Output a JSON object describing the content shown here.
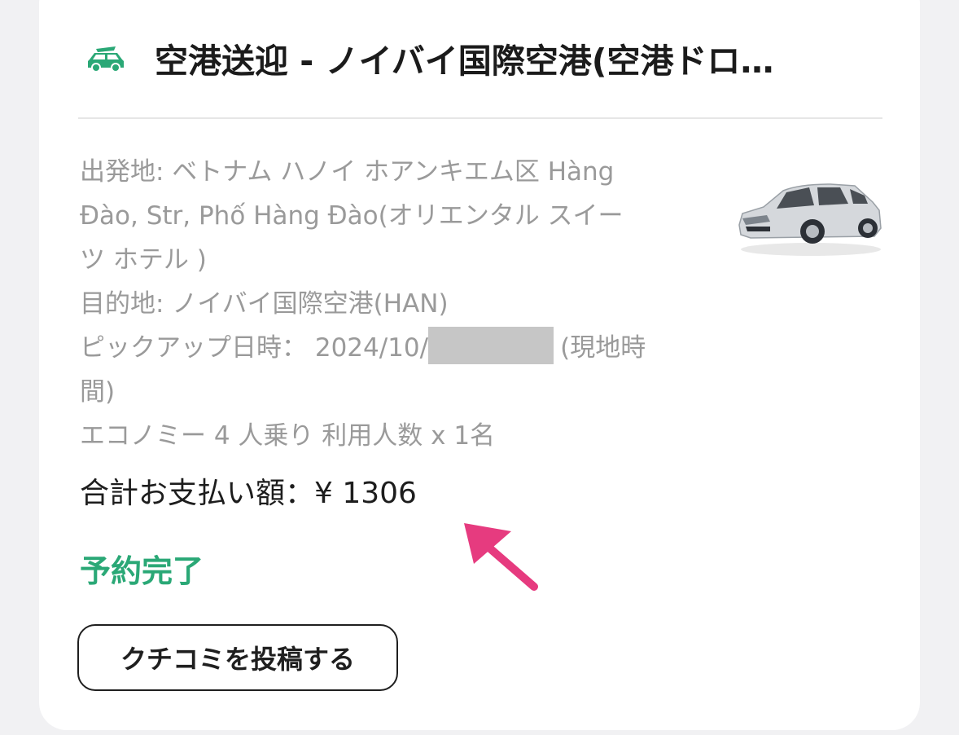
{
  "booking": {
    "title": "空港送迎 - ノイバイ国際空港(空港ドロ…",
    "origin_line1": "出発地: ベトナム ハノイ ホアンキエム区 Hàng",
    "origin_line2": "Đào, Str, Phố Hàng Đào(オリエンタル スイー",
    "origin_line3": "ツ ホテル )",
    "destination": "目的地: ノイバイ国際空港(HAN)",
    "pickup_prefix": "ピックアップ日時： 2024/10/",
    "pickup_suffix": "(現地時",
    "pickup_line2": "間)",
    "vehicle": "エコノミー 4 人乗り 利用人数 x 1名",
    "total": "合計お支払い額：¥ 1306",
    "status": "予約完了",
    "review_button": "クチコミを投稿する"
  },
  "icons": {
    "header": "car-icon",
    "annotation": "arrow-icon",
    "thumbnail": "car-image"
  },
  "colors": {
    "accent_green": "#2aa876",
    "arrow_pink": "#e63b7f",
    "redaction": "#c6c6c6"
  }
}
